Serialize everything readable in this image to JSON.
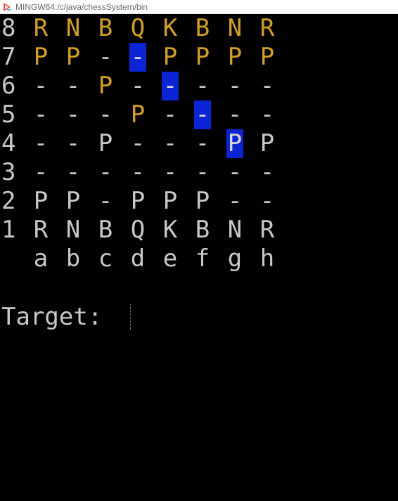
{
  "window": {
    "title": "MINGW64:/c/java/chessSystem/bin",
    "app_icon": "git-bash-icon"
  },
  "colors": {
    "background": "#000000",
    "text": "#c8c8c8",
    "gold": "#d4a017",
    "highlight": "#0a24d6"
  },
  "board": {
    "rows": [
      {
        "rank": "8",
        "cells": [
          {
            "text": "R",
            "gold": true
          },
          {
            "text": "N",
            "gold": true
          },
          {
            "text": "B",
            "gold": true
          },
          {
            "text": "Q",
            "gold": true
          },
          {
            "text": "K",
            "gold": true
          },
          {
            "text": "B",
            "gold": true
          },
          {
            "text": "N",
            "gold": true
          },
          {
            "text": "R",
            "gold": true
          }
        ]
      },
      {
        "rank": "7",
        "cells": [
          {
            "text": "P",
            "gold": true
          },
          {
            "text": "P",
            "gold": true
          },
          {
            "text": "-"
          },
          {
            "text": "-",
            "highlight": true
          },
          {
            "text": "P",
            "gold": true
          },
          {
            "text": "P",
            "gold": true
          },
          {
            "text": "P",
            "gold": true
          },
          {
            "text": "P",
            "gold": true
          }
        ]
      },
      {
        "rank": "6",
        "cells": [
          {
            "text": "-"
          },
          {
            "text": "-"
          },
          {
            "text": "P",
            "gold": true
          },
          {
            "text": "-"
          },
          {
            "text": "-",
            "highlight": true
          },
          {
            "text": "-"
          },
          {
            "text": "-"
          },
          {
            "text": "-"
          }
        ]
      },
      {
        "rank": "5",
        "cells": [
          {
            "text": "-"
          },
          {
            "text": "-"
          },
          {
            "text": "-"
          },
          {
            "text": "P",
            "gold": true
          },
          {
            "text": "-"
          },
          {
            "text": "-",
            "highlight": true
          },
          {
            "text": "-"
          },
          {
            "text": "-"
          }
        ]
      },
      {
        "rank": "4",
        "cells": [
          {
            "text": "-"
          },
          {
            "text": "-"
          },
          {
            "text": "P"
          },
          {
            "text": "-"
          },
          {
            "text": "-"
          },
          {
            "text": "-"
          },
          {
            "text": "P",
            "highlight": true
          },
          {
            "text": "P"
          }
        ]
      },
      {
        "rank": "3",
        "cells": [
          {
            "text": "-"
          },
          {
            "text": "-"
          },
          {
            "text": "-"
          },
          {
            "text": "-"
          },
          {
            "text": "-"
          },
          {
            "text": "-"
          },
          {
            "text": "-"
          },
          {
            "text": "-"
          }
        ]
      },
      {
        "rank": "2",
        "cells": [
          {
            "text": "P"
          },
          {
            "text": "P"
          },
          {
            "text": "-"
          },
          {
            "text": "P"
          },
          {
            "text": "P"
          },
          {
            "text": "P"
          },
          {
            "text": "-"
          },
          {
            "text": "-"
          }
        ]
      },
      {
        "rank": "1",
        "cells": [
          {
            "text": "R"
          },
          {
            "text": "N"
          },
          {
            "text": "B"
          },
          {
            "text": "Q"
          },
          {
            "text": "K"
          },
          {
            "text": "B"
          },
          {
            "text": "N"
          },
          {
            "text": "R"
          }
        ]
      }
    ],
    "files": [
      "a",
      "b",
      "c",
      "d",
      "e",
      "f",
      "g",
      "h"
    ]
  },
  "prompt": {
    "label": "Target: ",
    "value": ""
  }
}
